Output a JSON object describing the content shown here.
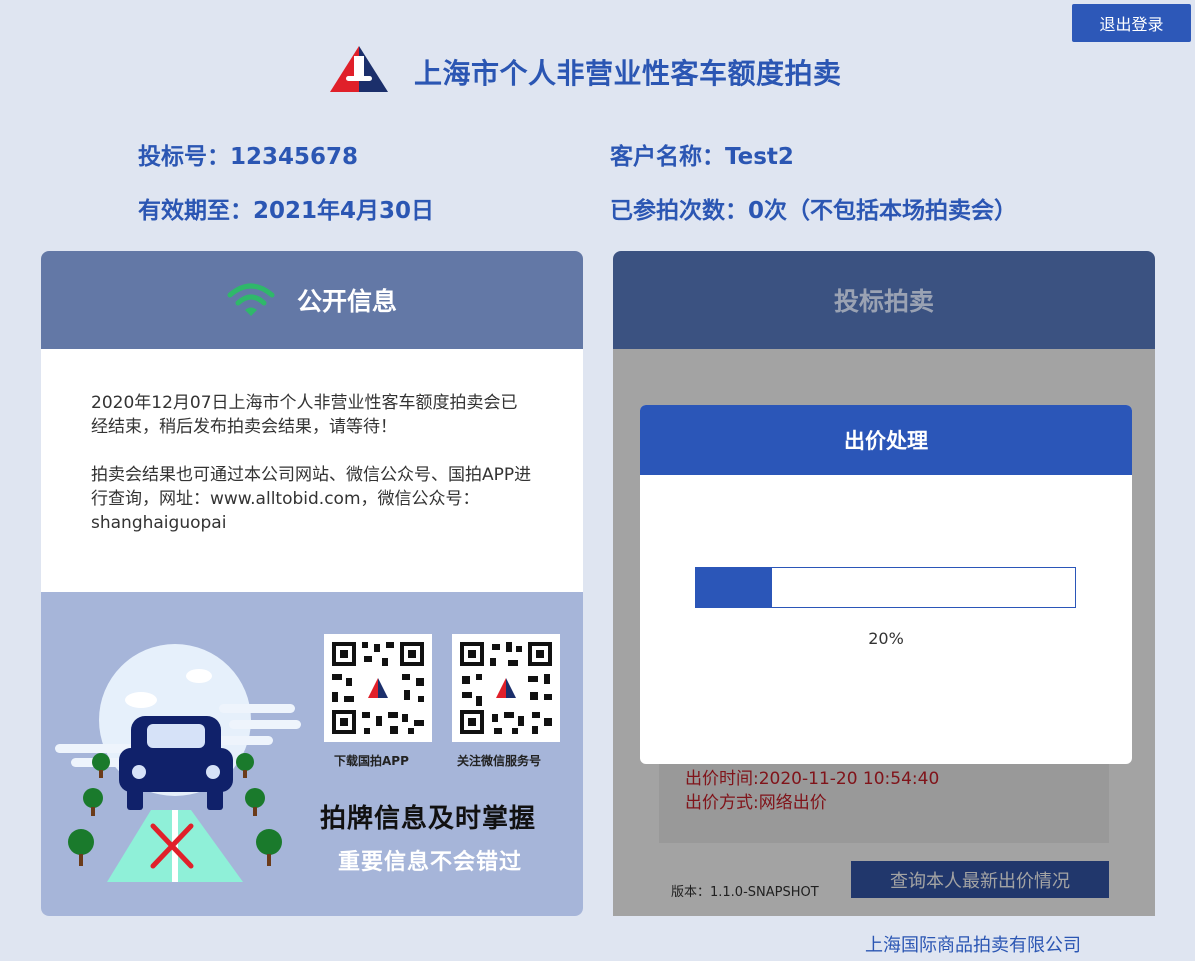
{
  "header": {
    "title": "上海市个人非营业性客车额度拍卖",
    "logout_label": "退出登录"
  },
  "user_info": {
    "bid_number": "投标号：12345678",
    "customer_name": "客户名称：Test2",
    "valid_until": "有效期至：2021年4月30日",
    "participation_count": "已参拍次数：0次（不包括本场拍卖会）"
  },
  "public_info": {
    "title": "公开信息",
    "notice_1": "2020年12月07日上海市个人非营业性客车额度拍卖会已经结束，稍后发布拍卖会结果，请等待！",
    "notice_2": "拍卖会结果也可通过本公司网站、微信公众号、国拍APP进行查询，网址：www.alltobid.com，微信公众号：shanghaiguopai",
    "qr_app_caption": "下载国拍APP",
    "qr_wechat_caption": "关注微信服务号",
    "slogan_main": "拍牌信息及时掌握",
    "slogan_sub": "重要信息不会错过"
  },
  "bidding": {
    "title": "投标拍卖",
    "bid_time": "出价时间:2020-11-20 10:54:40",
    "bid_method": "出价方式:网络出价",
    "version": "版本：1.1.0-SNAPSHOT",
    "query_button": "查询本人最新出价情况"
  },
  "modal": {
    "title": "出价处理",
    "progress": 0.2,
    "progress_text": "20%"
  },
  "footer": {
    "company": "上海国际商品拍卖有限公司"
  },
  "colors": {
    "primary": "#2b56b8",
    "background": "#dfe5f1",
    "alert_red": "#c9202a"
  }
}
